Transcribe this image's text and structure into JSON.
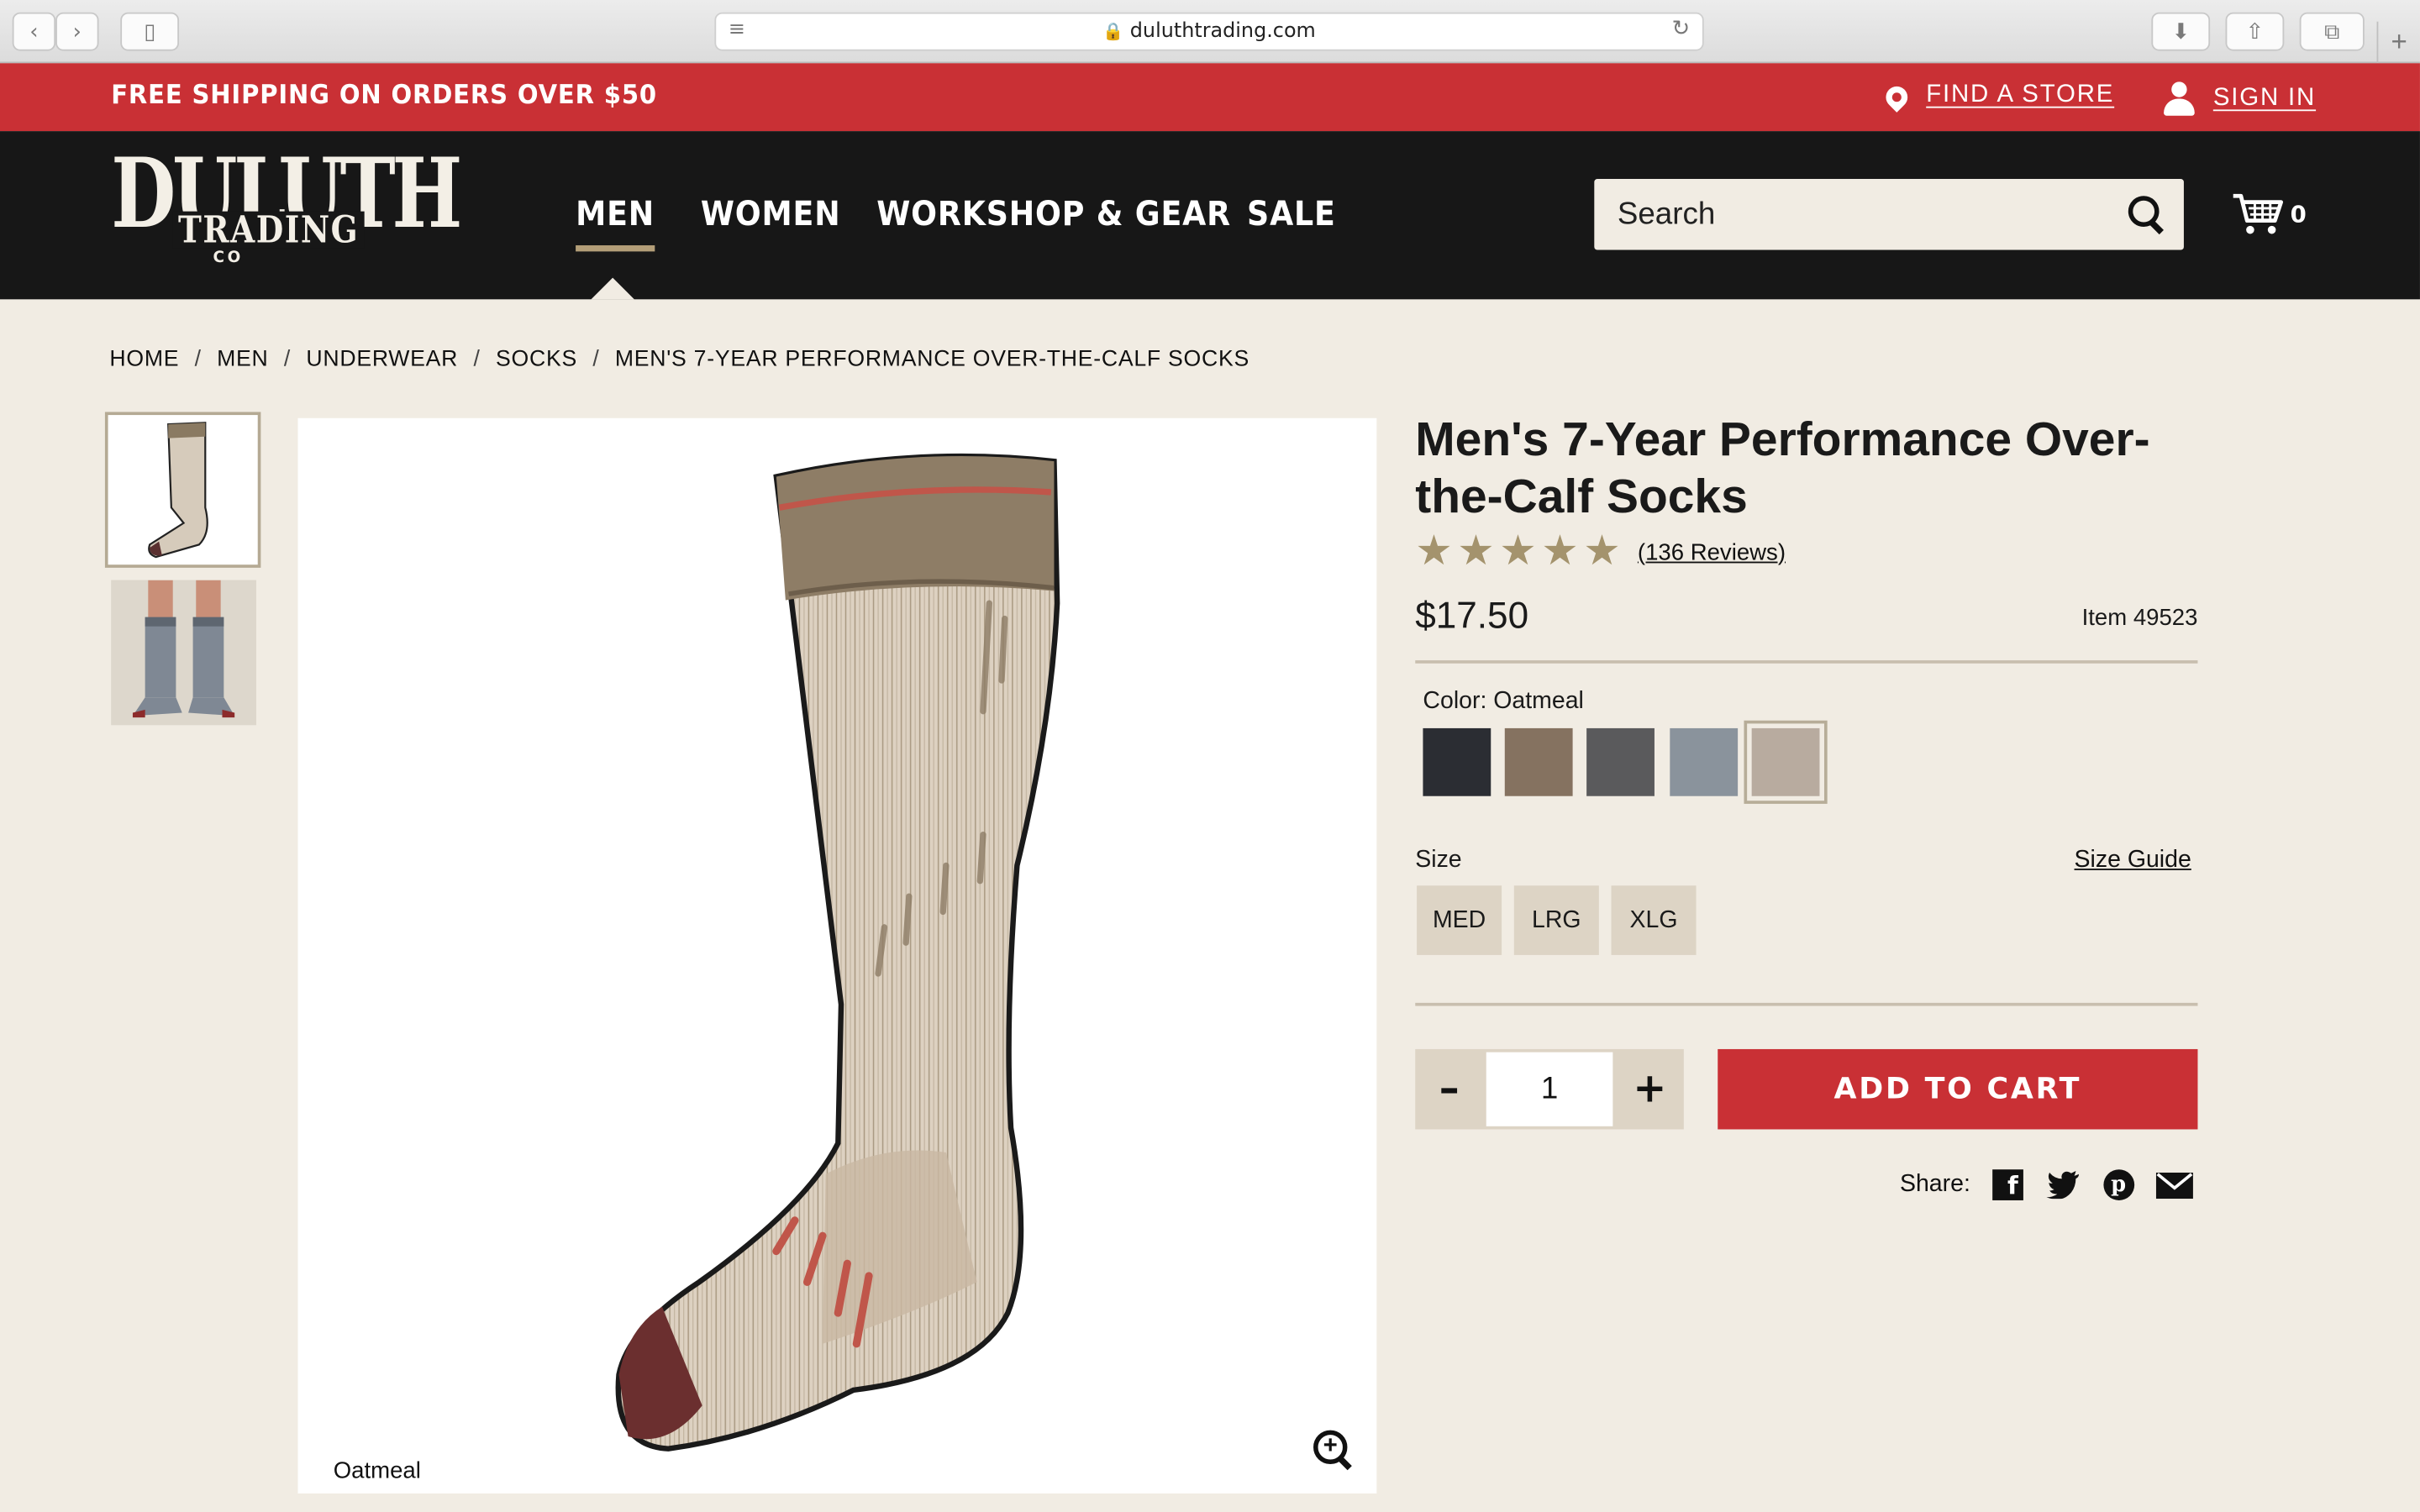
{
  "browser": {
    "url": "duluthtrading.com"
  },
  "promo": {
    "shipping": "FREE SHIPPING ON ORDERS OVER $50",
    "find_store": "FIND A STORE",
    "sign_in": "SIGN IN"
  },
  "header": {
    "logo_main": "DULUTH",
    "logo_sub": "TRADING",
    "logo_co": "CO",
    "nav": [
      "MEN",
      "WOMEN",
      "WORKSHOP & GEAR",
      "SALE"
    ],
    "search_placeholder": "Search",
    "cart_count": "0"
  },
  "breadcrumb": [
    "HOME",
    "MEN",
    "UNDERWEAR",
    "SOCKS",
    "MEN'S 7-YEAR PERFORMANCE OVER-THE-CALF SOCKS"
  ],
  "product": {
    "title": "Men's 7-Year Performance Over-the-Calf Socks",
    "rating": 5,
    "reviews": "(136 Reviews)",
    "price": "$17.50",
    "item": "Item 49523",
    "color_label": "Color: Oatmeal",
    "image_caption": "Oatmeal",
    "swatches": [
      {
        "name": "black",
        "color": "#2b2d33"
      },
      {
        "name": "brown-heather",
        "color": "#857260"
      },
      {
        "name": "charcoal",
        "color": "#5a5a5c"
      },
      {
        "name": "gray-blue",
        "color": "#8a939c"
      },
      {
        "name": "oatmeal",
        "color": "#b8ab9f",
        "selected": true
      }
    ],
    "size_label": "Size",
    "size_guide": "Size Guide",
    "sizes": [
      "MED",
      "LRG",
      "XLG"
    ],
    "quantity": "1",
    "minus": "–",
    "plus": "+",
    "add_to_cart": "ADD TO CART",
    "share_label": "Share:"
  },
  "colors": {
    "brand_red": "#c93035",
    "header_black": "#171717",
    "page_bg": "#f1ece3",
    "accent_tan": "#b39e78"
  }
}
